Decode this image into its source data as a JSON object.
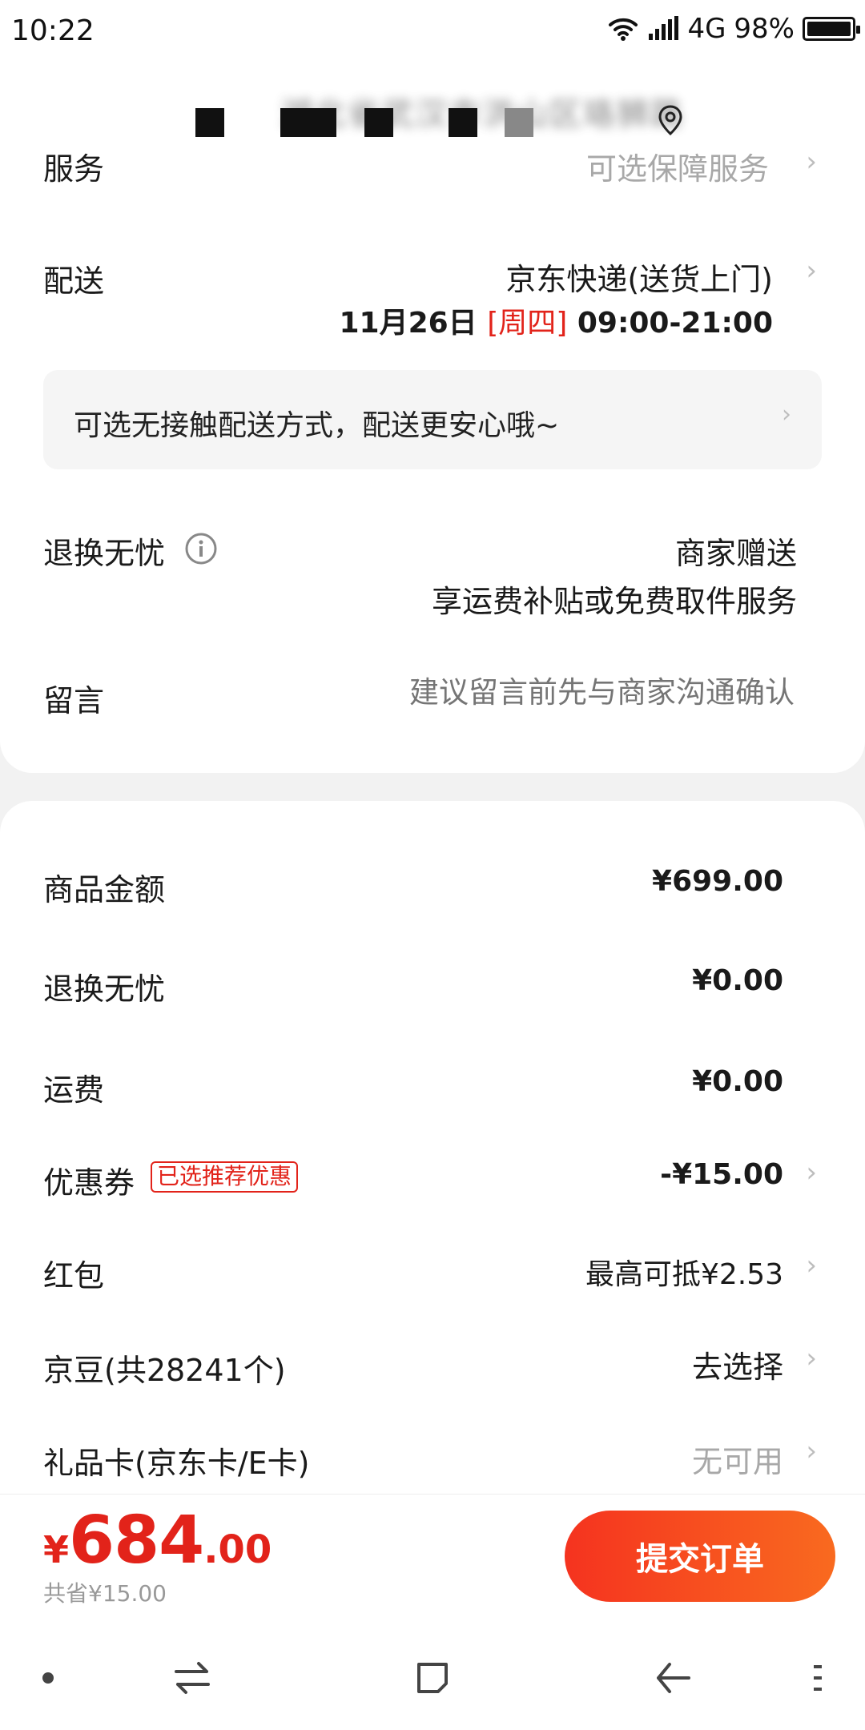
{
  "status_bar": {
    "time": "10:22",
    "network": "4G",
    "battery": "98%"
  },
  "address": {
    "text": "湖北省武汉市洪山区珞狮路"
  },
  "service": {
    "label": "服务",
    "value": "可选保障服务"
  },
  "delivery": {
    "label": "配送",
    "carrier": "京东快递(送货上门)",
    "date": "11月26日",
    "weekday": "[周四]",
    "time": "09:00-21:00"
  },
  "no_contact": {
    "text": "可选无接触配送方式，配送更安心哦~"
  },
  "return_worry_free": {
    "label": "退换无忧",
    "line1": "商家赠送",
    "line2": "享运费补贴或免费取件服务"
  },
  "message": {
    "label": "留言",
    "placeholder": "建议留言前先与商家沟通确认"
  },
  "summary": {
    "goods_amount_label": "商品金额",
    "goods_amount": "¥699.00",
    "return_label": "退换无忧",
    "return_amount": "¥0.00",
    "shipping_label": "运费",
    "shipping_amount": "¥0.00",
    "coupon_label": "优惠券",
    "coupon_tag": "已选推荐优惠",
    "coupon_amount": "-¥15.00",
    "redpacket_label": "红包",
    "redpacket_value": "最高可抵¥2.53",
    "jingdou_label": "京豆(共28241个)",
    "jingdou_value": "去选择",
    "giftcard_label": "礼品卡(京东卡/E卡)",
    "giftcard_value": "无可用"
  },
  "footer": {
    "yen": "¥",
    "total_int": "684",
    "total_dec": ".00",
    "saved": "共省¥15.00",
    "submit_label": "提交订单"
  },
  "colors": {
    "accent_red": "#e2231a",
    "button_gradient_start": "#f5331f",
    "button_gradient_end": "#f96a1f"
  },
  "icons": [
    "wifi-icon",
    "signal-icon",
    "battery-icon",
    "location-icon",
    "info-icon",
    "chevron-right-icon",
    "nav-dot-icon",
    "nav-switch-icon",
    "nav-home-icon",
    "nav-back-icon",
    "nav-menu-icon"
  ]
}
